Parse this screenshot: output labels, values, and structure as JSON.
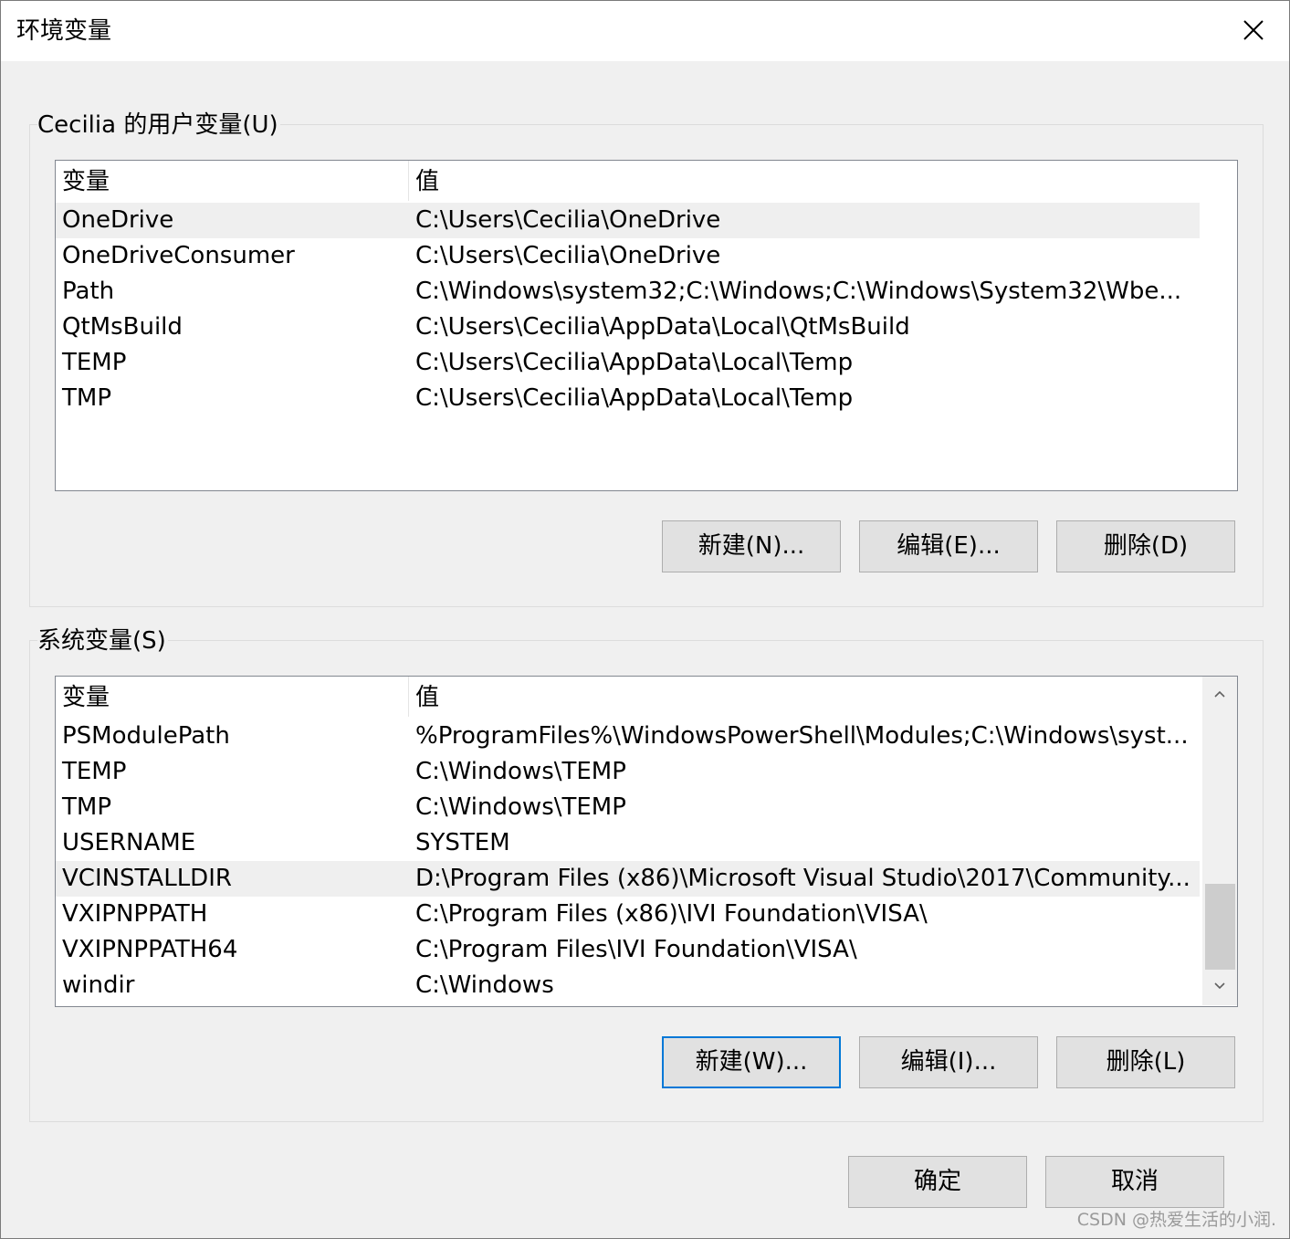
{
  "window": {
    "title": "环境变量",
    "close_icon": "close-icon"
  },
  "user_vars": {
    "group_label": "Cecilia 的用户变量(U)",
    "columns": [
      "变量",
      "值"
    ],
    "rows": [
      {
        "name": "OneDrive",
        "value": "C:\\Users\\Cecilia\\OneDrive",
        "selected": true
      },
      {
        "name": "OneDriveConsumer",
        "value": "C:\\Users\\Cecilia\\OneDrive",
        "selected": false
      },
      {
        "name": "Path",
        "value": "C:\\Windows\\system32;C:\\Windows;C:\\Windows\\System32\\Wbe...",
        "selected": false
      },
      {
        "name": "QtMsBuild",
        "value": "C:\\Users\\Cecilia\\AppData\\Local\\QtMsBuild",
        "selected": false
      },
      {
        "name": "TEMP",
        "value": "C:\\Users\\Cecilia\\AppData\\Local\\Temp",
        "selected": false
      },
      {
        "name": "TMP",
        "value": "C:\\Users\\Cecilia\\AppData\\Local\\Temp",
        "selected": false
      }
    ],
    "buttons": {
      "new": "新建(N)...",
      "edit": "编辑(E)...",
      "delete": "删除(D)"
    }
  },
  "system_vars": {
    "group_label": "系统变量(S)",
    "columns": [
      "变量",
      "值"
    ],
    "rows": [
      {
        "name": "PSModulePath",
        "value": "%ProgramFiles%\\WindowsPowerShell\\Modules;C:\\Windows\\syst...",
        "selected": false
      },
      {
        "name": "TEMP",
        "value": "C:\\Windows\\TEMP",
        "selected": false
      },
      {
        "name": "TMP",
        "value": "C:\\Windows\\TEMP",
        "selected": false
      },
      {
        "name": "USERNAME",
        "value": "SYSTEM",
        "selected": false
      },
      {
        "name": "VCINSTALLDIR",
        "value": "D:\\Program Files (x86)\\Microsoft Visual Studio\\2017\\Community...",
        "selected": true
      },
      {
        "name": "VXIPNPPATH",
        "value": "C:\\Program Files (x86)\\IVI Foundation\\VISA\\",
        "selected": false
      },
      {
        "name": "VXIPNPPATH64",
        "value": "C:\\Program Files\\IVI Foundation\\VISA\\",
        "selected": false
      },
      {
        "name": "windir",
        "value": "C:\\Windows",
        "selected": false
      }
    ],
    "buttons": {
      "new": "新建(W)...",
      "edit": "编辑(I)...",
      "delete": "删除(L)"
    }
  },
  "footer": {
    "ok": "确定",
    "cancel": "取消"
  },
  "watermark": "CSDN @热爱生活的小润."
}
